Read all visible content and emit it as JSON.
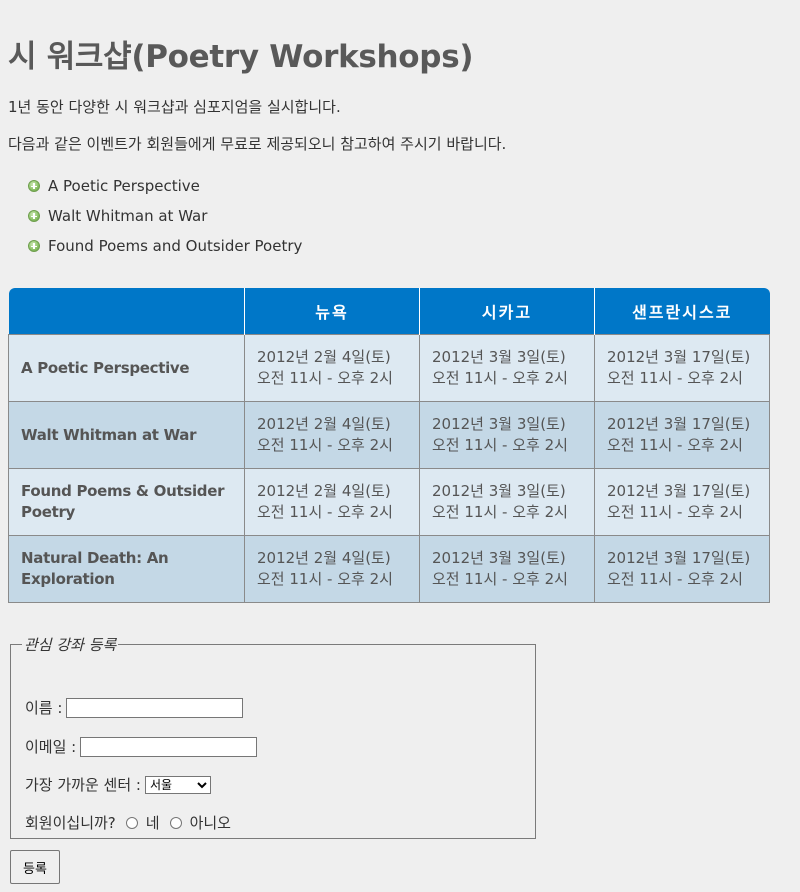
{
  "page": {
    "title": "시 워크샵(Poetry Workshops)",
    "intro_1": "1년 동안 다양한 시 워크샵과 심포지엄을 실시합니다.",
    "intro_2": "다음과 같은 이벤트가 회원들에게 무료로 제공되오니 참고하여 주시기 바랍니다."
  },
  "events": [
    {
      "label": "A Poetic Perspective",
      "icon": "plus-circle-icon"
    },
    {
      "label": "Walt Whitman at War",
      "icon": "plus-circle-icon"
    },
    {
      "label": "Found Poems and Outsider Poetry",
      "icon": "plus-circle-icon"
    }
  ],
  "table": {
    "headers": [
      "",
      "뉴욕",
      "시카고",
      "샌프란시스코"
    ],
    "rows": [
      {
        "course": "A Poetic Perspective",
        "cells": [
          {
            "date": "2012년 2월 4일(토)",
            "time": "오전 11시 - 오후 2시"
          },
          {
            "date": "2012년 3월 3일(토)",
            "time": "오전 11시 - 오후 2시"
          },
          {
            "date": "2012년 3월 17일(토)",
            "time": "오전 11시 - 오후 2시"
          }
        ]
      },
      {
        "course": "Walt Whitman at War",
        "cells": [
          {
            "date": "2012년 2월 4일(토)",
            "time": "오전 11시 - 오후 2시"
          },
          {
            "date": "2012년 3월 3일(토)",
            "time": "오전 11시 - 오후 2시"
          },
          {
            "date": "2012년 3월 17일(토)",
            "time": "오전 11시 - 오후 2시"
          }
        ]
      },
      {
        "course": "Found Poems & Outsider Poetry",
        "cells": [
          {
            "date": "2012년 2월 4일(토)",
            "time": "오전 11시 - 오후 2시"
          },
          {
            "date": "2012년 3월 3일(토)",
            "time": "오전 11시 - 오후 2시"
          },
          {
            "date": "2012년 3월 17일(토)",
            "time": "오전 11시 - 오후 2시"
          }
        ]
      },
      {
        "course": "Natural Death: An Exploration",
        "cells": [
          {
            "date": "2012년 2월 4일(토)",
            "time": "오전 11시 - 오후 2시"
          },
          {
            "date": "2012년 3월 3일(토)",
            "time": "오전 11시 - 오후 2시"
          },
          {
            "date": "2012년 3월 17일(토)",
            "time": "오전 11시 - 오후 2시"
          }
        ]
      }
    ],
    "colors": {
      "header_bg": "#0077c8",
      "row_light": "#dde9f2",
      "row_dark": "#c4d8e6"
    }
  },
  "form": {
    "legend": "관심 강좌 등록",
    "name_label": "이름 :",
    "name_value": "",
    "email_label": "이메일 :",
    "email_value": "",
    "center_label": "가장 가까운 센터 :",
    "center_selected": "서울",
    "member_label": "회원이십니까?",
    "member_yes": "네",
    "member_no": "아니오",
    "submit_label": "등록"
  }
}
